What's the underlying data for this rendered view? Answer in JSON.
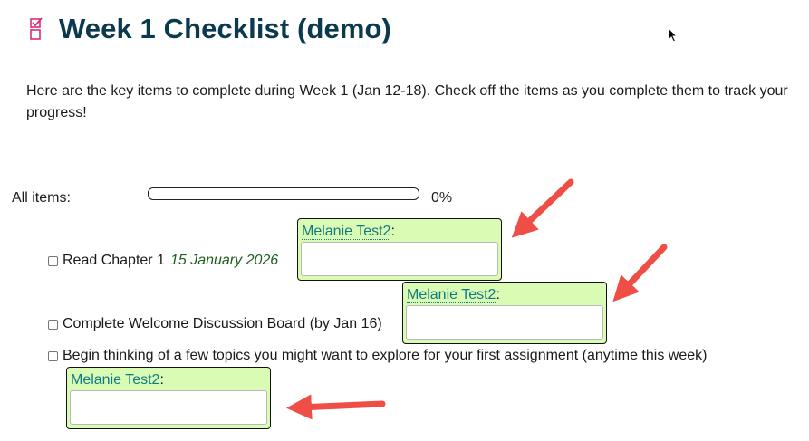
{
  "page": {
    "title": "Week 1 Checklist (demo)",
    "intro": "Here are the key items to complete during Week 1 (Jan 12-18). Check off the items as you complete them to track your progress!"
  },
  "progress": {
    "label": "All items:",
    "percent_text": "0%",
    "value": 0
  },
  "items": [
    {
      "label": "Read Chapter 1",
      "date": "15 January 2026",
      "checked": false
    },
    {
      "label": "Complete Welcome Discussion Board (by Jan 16)",
      "checked": false
    },
    {
      "label": "Begin thinking of a few topics you might want to explore for your first assignment (anytime this week)",
      "checked": false
    }
  ],
  "notes": [
    {
      "user": "Melanie Test2",
      "sep": ":",
      "value": ""
    },
    {
      "user": "Melanie Test2",
      "sep": ":",
      "value": ""
    },
    {
      "user": "Melanie Test2",
      "sep": ":",
      "value": ""
    }
  ],
  "colors": {
    "title": "#0b3a4f",
    "icon": "#d6307a",
    "note_bg": "#d9fbb4",
    "user_link": "#0f7a83",
    "date": "#1e5e1e",
    "arrow": "#ee4e45"
  },
  "icons": [
    "checklist-icon",
    "mouse-cursor-icon"
  ]
}
